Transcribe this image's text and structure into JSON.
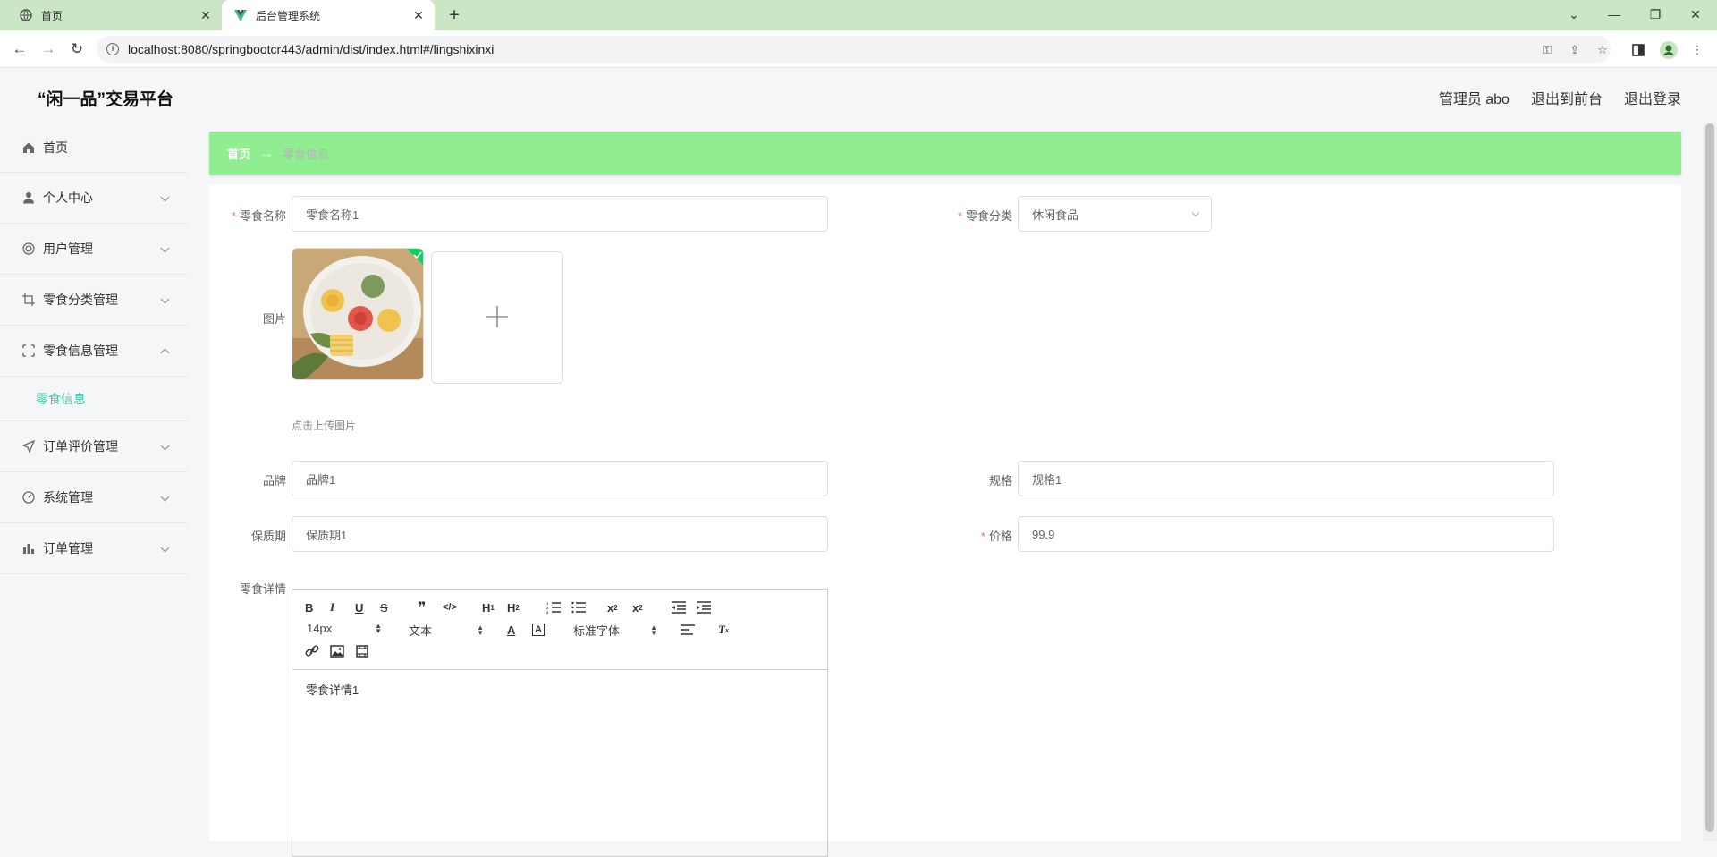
{
  "browser": {
    "tabs": [
      {
        "title": "首页",
        "icon": "globe-icon"
      },
      {
        "title": "后台管理系统",
        "icon": "vue-logo-icon"
      }
    ],
    "url": "localhost:8080/springbootcr443/admin/dist/index.html#/lingshixinxi"
  },
  "header": {
    "brand": "“闲一品”交易平台",
    "user": "管理员 abo",
    "to_front": "退出到前台",
    "logout": "退出登录"
  },
  "sidebar": {
    "items": [
      {
        "label": "首页",
        "icon": "home-icon"
      },
      {
        "label": "个人中心",
        "icon": "user-icon"
      },
      {
        "label": "用户管理",
        "icon": "users-icon"
      },
      {
        "label": "零食分类管理",
        "icon": "crop-icon"
      },
      {
        "label": "零食信息管理",
        "icon": "fullscreen-icon"
      },
      {
        "label": "订单评价管理",
        "icon": "send-icon"
      },
      {
        "label": "系统管理",
        "icon": "gauge-icon"
      },
      {
        "label": "订单管理",
        "icon": "bar-chart-icon"
      }
    ],
    "sub_active": "零食信息"
  },
  "breadcrumb": {
    "home": "首页",
    "current": "零食信息"
  },
  "form": {
    "name_label": "零食名称",
    "name_value": "零食名称1",
    "category_label": "零食分类",
    "category_value": "休闲食品",
    "image_label": "图片",
    "upload_tip": "点击上传图片",
    "brand_label": "品牌",
    "brand_value": "品牌1",
    "spec_label": "规格",
    "spec_value": "规格1",
    "shelf_label": "保质期",
    "shelf_value": "保质期1",
    "price_label": "价格",
    "price_value": "99.9",
    "detail_label": "零食详情",
    "detail_value": "零食详情1"
  },
  "editor": {
    "font_size": "14px",
    "header": "文本",
    "font": "标准字体"
  },
  "colors": {
    "breadcrumb_bg": "#90ee90",
    "accent": "#3cc9a8",
    "required": "#f56c6c"
  }
}
